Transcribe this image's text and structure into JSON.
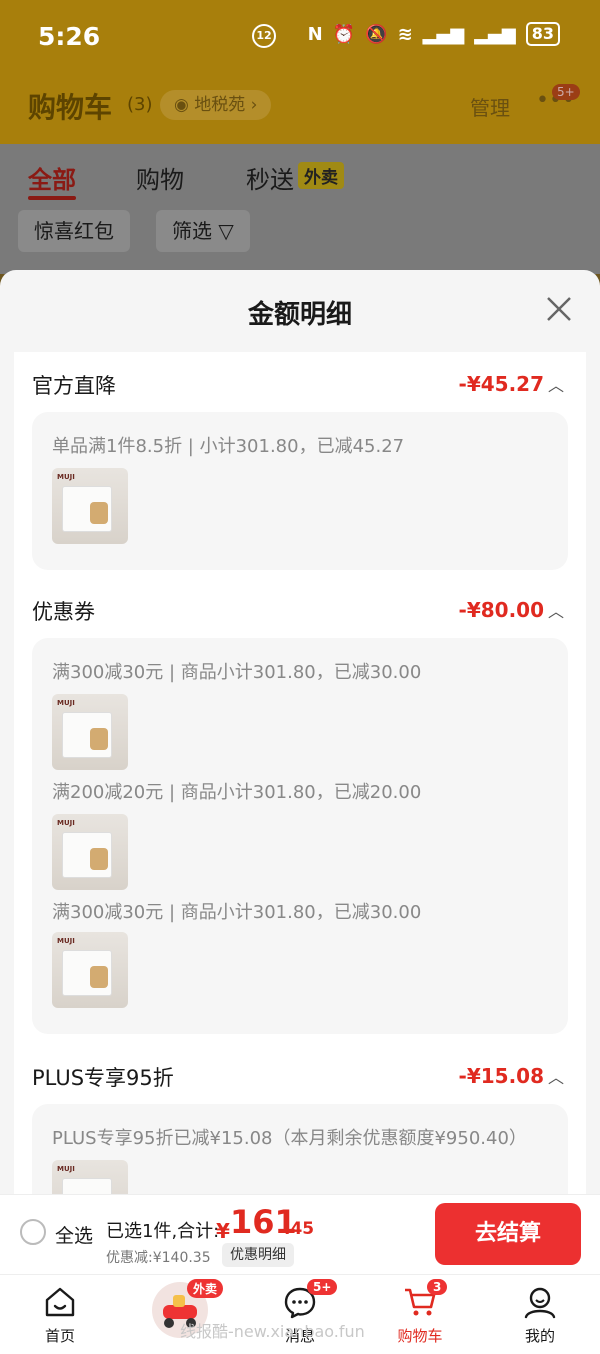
{
  "status": {
    "time": "5:26",
    "battery": "83",
    "mid_icon": "12"
  },
  "header": {
    "title": "购物车",
    "count": "(3)",
    "location": "地税苑",
    "manage": "管理",
    "more": "•••",
    "badge": "5+"
  },
  "tabs": {
    "all": "全部",
    "shop": "购物",
    "flash": "秒送",
    "takeout": "外卖"
  },
  "chips": {
    "red_packet": "惊喜红包",
    "filter": "筛选"
  },
  "sheet": {
    "title": "金额明细",
    "sections": [
      {
        "name": "官方直降",
        "amount": "-¥45.27",
        "lines": [
          "单品满1件8.5折 | 小计301.80，已减45.27"
        ]
      },
      {
        "name": "优惠券",
        "amount": "-¥80.00",
        "lines": [
          "满300减30元 | 商品小计301.80，已减30.00",
          "满200减20元 | 商品小计301.80，已减20.00",
          "满300减30元 | 商品小计301.80，已减30.00"
        ]
      },
      {
        "name": "PLUS专享95折",
        "amount": "-¥15.08",
        "lines": [
          "PLUS专享95折已减¥15.08（本月剩余优惠额度¥950.40）"
        ]
      }
    ],
    "thumb_logo": "MUJI"
  },
  "bottom": {
    "select_all": "全选",
    "summary": "已选1件,合计:",
    "yuan": "¥",
    "price_int": "161",
    "price_dec": ".45",
    "discount": "优惠减:¥140.35",
    "detail_button": "优惠明细",
    "checkout": "去结算"
  },
  "tabbar": {
    "home": "首页",
    "waimai_badge": "外卖",
    "messages": "消息",
    "messages_badge": "5+",
    "cart": "购物车",
    "cart_badge": "3",
    "mine": "我的"
  },
  "watermark": "线报酷-new.xianbao.fun"
}
